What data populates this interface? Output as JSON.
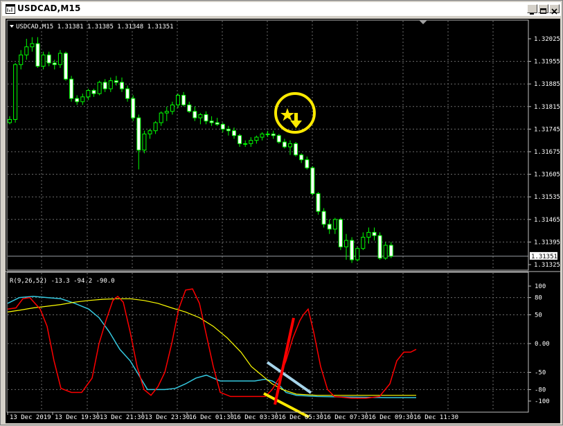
{
  "window": {
    "title": "USDCAD,M15",
    "buttons": [
      "minimize",
      "maximize",
      "close"
    ]
  },
  "main_chart": {
    "info": "USDCAD,M15  1.31381 1.31385 1.31348 1.31351",
    "current_price": "1.31351",
    "price_ticks": [
      "1.32025",
      "1.31955",
      "1.31885",
      "1.31815",
      "1.31745",
      "1.31675",
      "1.31605",
      "1.31535",
      "1.31465",
      "1.31395",
      "1.31325"
    ]
  },
  "indicator": {
    "label": "R(9,26,52) -13.3 -94.2 -90.0",
    "ticks": [
      "100",
      "80",
      "50",
      "0.00",
      "-50",
      "-80",
      "-100"
    ]
  },
  "time_axis": [
    "13 Dec 2019",
    "13 Dec 19:30",
    "13 Dec 21:30",
    "13 Dec 23:30",
    "16 Dec 01:30",
    "16 Dec 03:30",
    "16 Dec 05:30",
    "16 Dec 07:30",
    "16 Dec 09:30",
    "16 Dec 11:30"
  ],
  "colors": {
    "background": "#000000",
    "candle": "#00ff00",
    "grid": "#6e6e6e",
    "red_line": "#ff0000",
    "cyan_line": "#35c9e0",
    "yellow_line": "#ffff00",
    "annotation_circle": "#ffea00",
    "annotation_light_blue": "#a6d4ea"
  }
}
